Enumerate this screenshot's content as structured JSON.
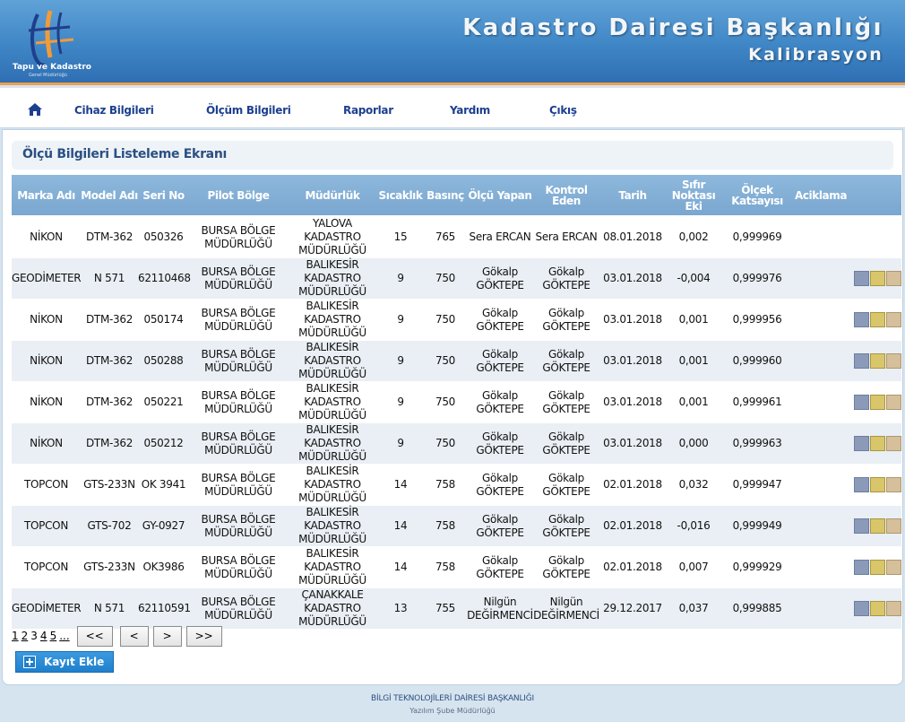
{
  "header": {
    "logo_line1": "Tapu ve Kadastro",
    "logo_line2": "Genel Müdürlüğü",
    "title": "Kadastro Dairesi Başkanlığı",
    "subtitle": "Kalibrasyon"
  },
  "nav": {
    "items": [
      {
        "label": "Cihaz Bilgileri"
      },
      {
        "label": "Ölçüm Bilgileri"
      },
      {
        "label": "Raporlar"
      },
      {
        "label": "Yardım"
      },
      {
        "label": "Çıkış"
      }
    ]
  },
  "main": {
    "section_title": "Ölçü Bilgileri Listeleme Ekranı",
    "columns": [
      "Marka Adı",
      "Model Adı",
      "Seri No",
      "Pilot Bölge",
      "Müdürlük",
      "Sıcaklık",
      "Basınç",
      "Ölçü Yapan",
      "Kontrol Eden",
      "Tarih",
      "Sıfır Noktası Eki",
      "Ölçek Katsayısı",
      "Aciklama"
    ],
    "rows": [
      {
        "marka": "NİKON",
        "model": "DTM-362",
        "seri": "050326",
        "bolge": "BURSA BÖLGE MÜDÜRLÜĞÜ",
        "mudurluk": "YALOVA KADASTRO MÜDÜRLÜĞÜ",
        "sicaklik": "15",
        "basinc": "765",
        "olcu_yapan": "Sera ERCAN",
        "kontrol_eden": "Sera ERCAN",
        "tarih": "08.01.2018",
        "sifir": "0,002",
        "katsayi": "0,999969",
        "aciklama": "",
        "has_actions": false
      },
      {
        "marka": "GEODİMETER",
        "model": "N 571",
        "seri": "62110468",
        "bolge": "BURSA BÖLGE MÜDÜRLÜĞÜ",
        "mudurluk": "BALIKESİR KADASTRO MÜDÜRLÜĞÜ",
        "sicaklik": "9",
        "basinc": "750",
        "olcu_yapan": "Gökalp GÖKTEPE",
        "kontrol_eden": "Gökalp GÖKTEPE",
        "tarih": "03.01.2018",
        "sifir": "-0,004",
        "katsayi": "0,999976",
        "aciklama": "",
        "has_actions": true
      },
      {
        "marka": "NİKON",
        "model": "DTM-362",
        "seri": "050174",
        "bolge": "BURSA BÖLGE MÜDÜRLÜĞÜ",
        "mudurluk": "BALIKESİR KADASTRO MÜDÜRLÜĞÜ",
        "sicaklik": "9",
        "basinc": "750",
        "olcu_yapan": "Gökalp GÖKTEPE",
        "kontrol_eden": "Gökalp GÖKTEPE",
        "tarih": "03.01.2018",
        "sifir": "0,001",
        "katsayi": "0,999956",
        "aciklama": "",
        "has_actions": true
      },
      {
        "marka": "NİKON",
        "model": "DTM-362",
        "seri": "050288",
        "bolge": "BURSA BÖLGE MÜDÜRLÜĞÜ",
        "mudurluk": "BALIKESİR KADASTRO MÜDÜRLÜĞÜ",
        "sicaklik": "9",
        "basinc": "750",
        "olcu_yapan": "Gökalp GÖKTEPE",
        "kontrol_eden": "Gökalp GÖKTEPE",
        "tarih": "03.01.2018",
        "sifir": "0,001",
        "katsayi": "0,999960",
        "aciklama": "",
        "has_actions": true
      },
      {
        "marka": "NİKON",
        "model": "DTM-362",
        "seri": "050221",
        "bolge": "BURSA BÖLGE MÜDÜRLÜĞÜ",
        "mudurluk": "BALIKESİR KADASTRO MÜDÜRLÜĞÜ",
        "sicaklik": "9",
        "basinc": "750",
        "olcu_yapan": "Gökalp GÖKTEPE",
        "kontrol_eden": "Gökalp GÖKTEPE",
        "tarih": "03.01.2018",
        "sifir": "0,001",
        "katsayi": "0,999961",
        "aciklama": "",
        "has_actions": true
      },
      {
        "marka": "NİKON",
        "model": "DTM-362",
        "seri": "050212",
        "bolge": "BURSA BÖLGE MÜDÜRLÜĞÜ",
        "mudurluk": "BALIKESİR KADASTRO MÜDÜRLÜĞÜ",
        "sicaklik": "9",
        "basinc": "750",
        "olcu_yapan": "Gökalp GÖKTEPE",
        "kontrol_eden": "Gökalp GÖKTEPE",
        "tarih": "03.01.2018",
        "sifir": "0,000",
        "katsayi": "0,999963",
        "aciklama": "",
        "has_actions": true
      },
      {
        "marka": "TOPCON",
        "model": "GTS-233N",
        "seri": "OK 3941",
        "bolge": "BURSA BÖLGE MÜDÜRLÜĞÜ",
        "mudurluk": "BALIKESİR KADASTRO MÜDÜRLÜĞÜ",
        "sicaklik": "14",
        "basinc": "758",
        "olcu_yapan": "Gökalp GÖKTEPE",
        "kontrol_eden": "Gökalp GÖKTEPE",
        "tarih": "02.01.2018",
        "sifir": "0,032",
        "katsayi": "0,999947",
        "aciklama": "",
        "has_actions": true
      },
      {
        "marka": "TOPCON",
        "model": "GTS-702",
        "seri": "GY-0927",
        "bolge": "BURSA BÖLGE MÜDÜRLÜĞÜ",
        "mudurluk": "BALIKESİR KADASTRO MÜDÜRLÜĞÜ",
        "sicaklik": "14",
        "basinc": "758",
        "olcu_yapan": "Gökalp GÖKTEPE",
        "kontrol_eden": "Gökalp GÖKTEPE",
        "tarih": "02.01.2018",
        "sifir": "-0,016",
        "katsayi": "0,999949",
        "aciklama": "",
        "has_actions": true
      },
      {
        "marka": "TOPCON",
        "model": "GTS-233N",
        "seri": "OK3986",
        "bolge": "BURSA BÖLGE MÜDÜRLÜĞÜ",
        "mudurluk": "BALIKESİR KADASTRO MÜDÜRLÜĞÜ",
        "sicaklik": "14",
        "basinc": "758",
        "olcu_yapan": "Gökalp GÖKTEPE",
        "kontrol_eden": "Gökalp GÖKTEPE",
        "tarih": "02.01.2018",
        "sifir": "0,007",
        "katsayi": "0,999929",
        "aciklama": "",
        "has_actions": true
      },
      {
        "marka": "GEODİMETER",
        "model": "N 571",
        "seri": "62110591",
        "bolge": "BURSA BÖLGE MÜDÜRLÜĞÜ",
        "mudurluk": "ÇANAKKALE KADASTRO MÜDÜRLÜĞÜ",
        "sicaklik": "13",
        "basinc": "755",
        "olcu_yapan": "Nilgün DEĞİRMENCİ",
        "kontrol_eden": "Nilgün DEĞİRMENCİ",
        "tarih": "29.12.2017",
        "sifir": "0,037",
        "katsayi": "0,999885",
        "aciklama": "",
        "has_actions": true
      }
    ],
    "pager": {
      "pages": [
        "1",
        "2",
        "3",
        "4",
        "5",
        "..."
      ],
      "current": "3",
      "first": "<<",
      "prev": "<",
      "next": ">",
      "last": ">>"
    },
    "add_button": "Kayıt Ekle"
  },
  "footer": {
    "line1": "BİLGİ TEKNOLOJİLERİ DAİRESİ BAŞKANLIĞI",
    "line2": "Yazılım Şube Müdürlüğü"
  },
  "icons": {
    "home": "home-icon",
    "view": "pen-icon",
    "edit": "pencil-icon",
    "delete": "document-icon",
    "add": "plus-icon"
  }
}
